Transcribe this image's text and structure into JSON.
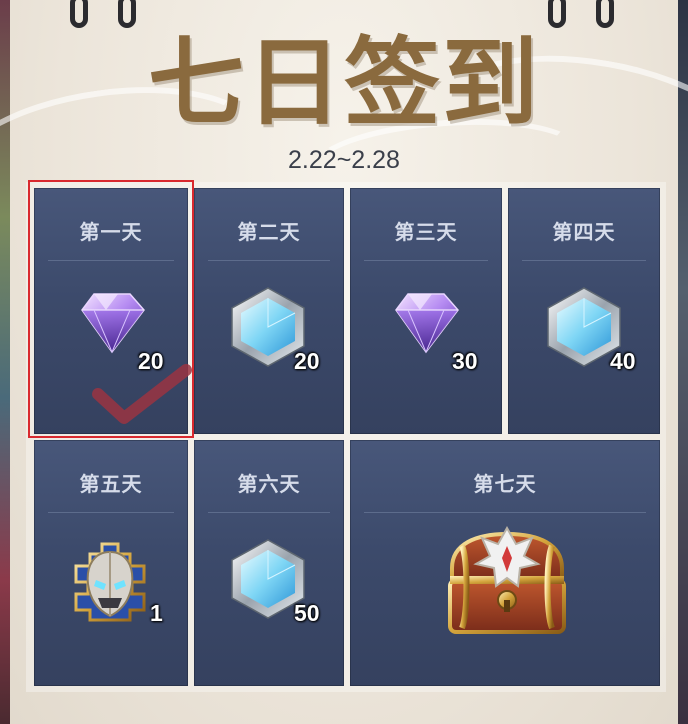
{
  "header": {
    "title": "七日签到",
    "date_range": "2.22~2.28"
  },
  "days": [
    {
      "label": "第一天",
      "reward": "purple-gem",
      "qty": "20",
      "claimed": true,
      "selected": true
    },
    {
      "label": "第二天",
      "reward": "blue-crystal",
      "qty": "20",
      "claimed": false
    },
    {
      "label": "第三天",
      "reward": "purple-gem",
      "qty": "30",
      "claimed": false
    },
    {
      "label": "第四天",
      "reward": "blue-crystal",
      "qty": "40",
      "claimed": false
    },
    {
      "label": "第五天",
      "reward": "hero-helmet-fragment",
      "qty": "1",
      "claimed": false
    },
    {
      "label": "第六天",
      "reward": "blue-crystal",
      "qty": "50",
      "claimed": false
    },
    {
      "label": "第七天",
      "reward": "treasure-chest",
      "qty": "",
      "claimed": false
    }
  ],
  "colors": {
    "card": "#3c4a6b",
    "title": "#8a6a3e",
    "highlight": "#d9292e",
    "check": "#9a3442"
  }
}
